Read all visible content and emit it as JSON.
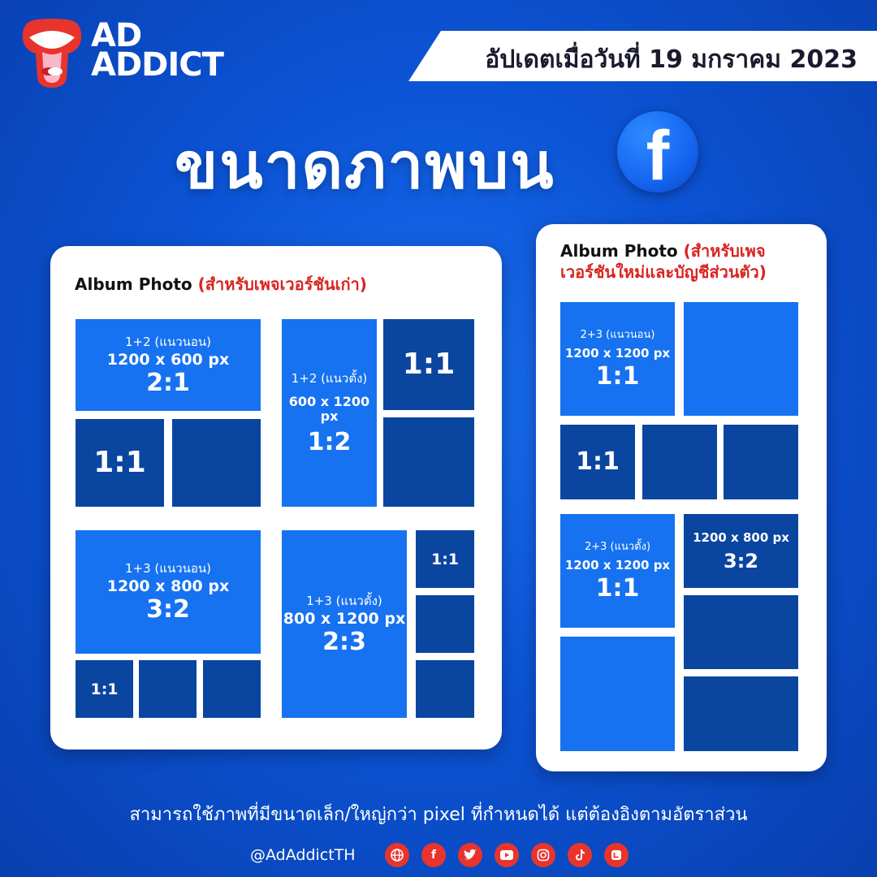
{
  "brand": {
    "line1": "AD",
    "line2": "ADDICT"
  },
  "update_date": "อัปเดตเมื่อวันที่ 19 มกราคม 2023",
  "title": "ขนาดภาพบน",
  "fb_glyph": "f",
  "left_card": {
    "title": "Album Photo",
    "title_note": "(สำหรับเพจเวอร์ชันเก่า)",
    "tiles": {
      "a1": {
        "sub": "1+2 (แนวนอน)",
        "size": "1200 x 600 px",
        "ratio": "2:1"
      },
      "a2": {
        "ratio": "1:1"
      },
      "b1": {
        "sub": "1+2 (แนวตั้ง)",
        "size": "600 x 1200 px",
        "ratio": "1:2"
      },
      "b2": {
        "ratio": "1:1"
      },
      "c1": {
        "sub": "1+3 (แนวนอน)",
        "size": "1200 x 800 px",
        "ratio": "3:2"
      },
      "c2": {
        "ratio": "1:1"
      },
      "d1": {
        "sub": "1+3 (แนวตั้ง)",
        "size": "800 x 1200 px",
        "ratio": "2:3"
      },
      "d2": {
        "ratio": "1:1"
      }
    }
  },
  "right_card": {
    "title": "Album Photo",
    "title_note_1": "(สำหรับเพจ",
    "title_note_2": "เวอร์ชันใหม่และบัญชีส่วนตัว)",
    "tiles": {
      "e1": {
        "sub": "2+3 (แนวนอน)",
        "size": "1200 x 1200 px",
        "ratio": "1:1"
      },
      "e2": {
        "ratio": "1:1"
      },
      "f1": {
        "sub": "2+3 (แนวตั้ง)",
        "size": "1200 x 1200 px",
        "ratio": "1:1"
      },
      "f2": {
        "size": "1200 x 800 px",
        "ratio": "3:2"
      }
    }
  },
  "footer_note": "สามารถใช้ภาพที่มีขนาดเล็ก/ใหญ่กว่า pixel ที่กำหนดได้ แต่ต้องอิงตามอัตราส่วน",
  "handle": "@AdAddictTH",
  "social_icons": [
    "globe-icon",
    "facebook-icon",
    "twitter-icon",
    "youtube-icon",
    "instagram-icon",
    "tiktok-icon",
    "line-icon"
  ],
  "colors": {
    "background": "#0c54d6",
    "tile_light": "#1672f0",
    "tile_dark": "#0a45a0",
    "accent_red": "#d9241f",
    "social_red": "#e8342c"
  }
}
